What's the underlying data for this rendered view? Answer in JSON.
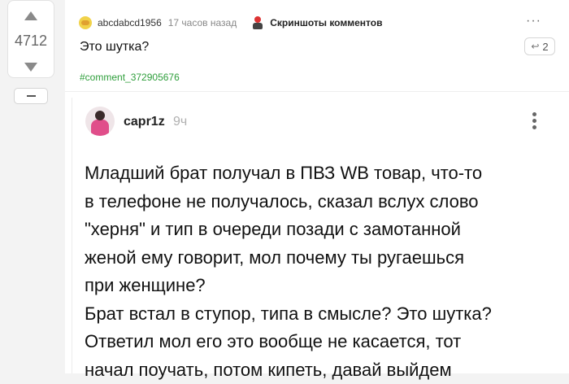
{
  "rating": {
    "count": "4712"
  },
  "parent_comment": {
    "author": "abcdabcd1956",
    "time": "17 часов назад",
    "community": "Скриншоты комментов",
    "text": "Это шутка?",
    "replies_count": "2",
    "hashtag": "#comment_372905676"
  },
  "reply_comment": {
    "author": "capr1z",
    "time": "9ч",
    "lines": [
      "Младший брат получал в ПВЗ WB товар, что-то",
      "в телефоне не получалось, сказал вслух слово",
      "\"херня\" и тип в очереди позади с замотанной",
      "женой ему говорит, мол почему ты ругаешься",
      "при женщине?",
      "Брат встал в ступор, типа в смысле? Это шутка?",
      "Ответил мол его это вообще не касается, тот",
      "начал поучать, потом кипеть, давай выйдем"
    ]
  },
  "colors": {
    "hashtag": "#2e9e3b",
    "background": "#f3f3f3",
    "card": "#ffffff"
  }
}
